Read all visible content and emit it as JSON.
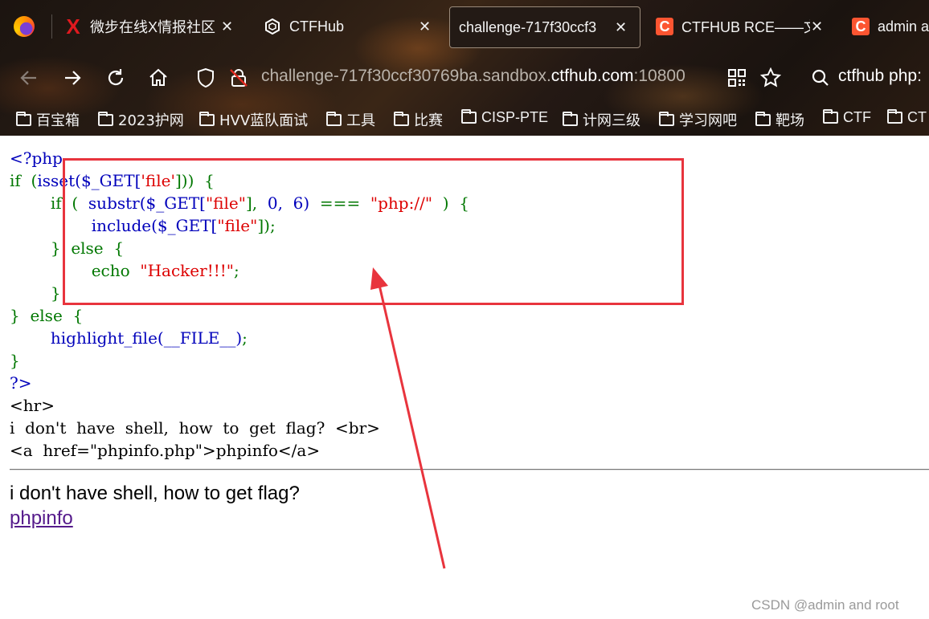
{
  "tabs": [
    {
      "title": "微步在线X情报社区",
      "icon": "X",
      "icon_color": "#e0191f"
    },
    {
      "title": "CTFHub",
      "icon": "ctfhub"
    },
    {
      "title": "challenge-717f30ccf3",
      "icon": "",
      "active": true
    },
    {
      "title": "CTFHUB RCE——文",
      "icon": "C",
      "icon_color": "#fc5531"
    },
    {
      "title": "admin a",
      "icon": "C",
      "icon_color": "#fc5531"
    }
  ],
  "url": {
    "prefix": "challenge-717f30ccf30769ba.sandbox.",
    "domain": "ctfhub.com",
    "port": ":10800"
  },
  "search_text": "ctfhub php:",
  "bookmarks": [
    "百宝箱",
    "2023护网",
    "HVV蓝队面试",
    "工具",
    "比赛",
    "CISP-PTE",
    "计网三级",
    "学习网吧",
    "靶场",
    "CTF",
    "CT"
  ],
  "source": {
    "l1": "<?php",
    "l2_kw": "if",
    "l2_a": "(",
    "l2_fn": "isset($_GET[",
    "l2_str": "'file'",
    "l2_b": "]))",
    "l2_c": "{",
    "l3_kw": "if",
    "l3_a": "(",
    "l3_fn": "substr($_GET[",
    "l3_str": "\"file\"",
    "l3_b": "],",
    "l3_n1": "0,",
    "l3_n2": "6)",
    "l3_op": "===",
    "l3_str2": "\"php://\"",
    "l3_c": ")",
    "l3_d": "{",
    "l4_fn": "include($_GET[",
    "l4_str": "\"file\"",
    "l4_b": "]);",
    "l5_a": "}",
    "l5_kw": "else",
    "l5_b": "{",
    "l6_kw": "echo",
    "l6_str": "\"Hacker!!!\"",
    "l6_b": ";",
    "l7": "}",
    "l8_a": "}",
    "l8_kw": "else",
    "l8_b": "{",
    "l9_fn": "highlight_file(__FILE__)",
    "l9_b": ";",
    "l10": "}",
    "l11": "?>",
    "l12": "<hr>",
    "l13": "i  don't  have  shell,  how  to  get  flag?  <br>",
    "l14": "<a  href=\"phpinfo.php\">phpinfo</a>"
  },
  "page_text": "i don't have shell, how to get flag?",
  "page_link": "phpinfo",
  "watermark": "CSDN @admin and root",
  "colors": {
    "annotation_red": "#e8343d",
    "link": "#551a8b"
  }
}
